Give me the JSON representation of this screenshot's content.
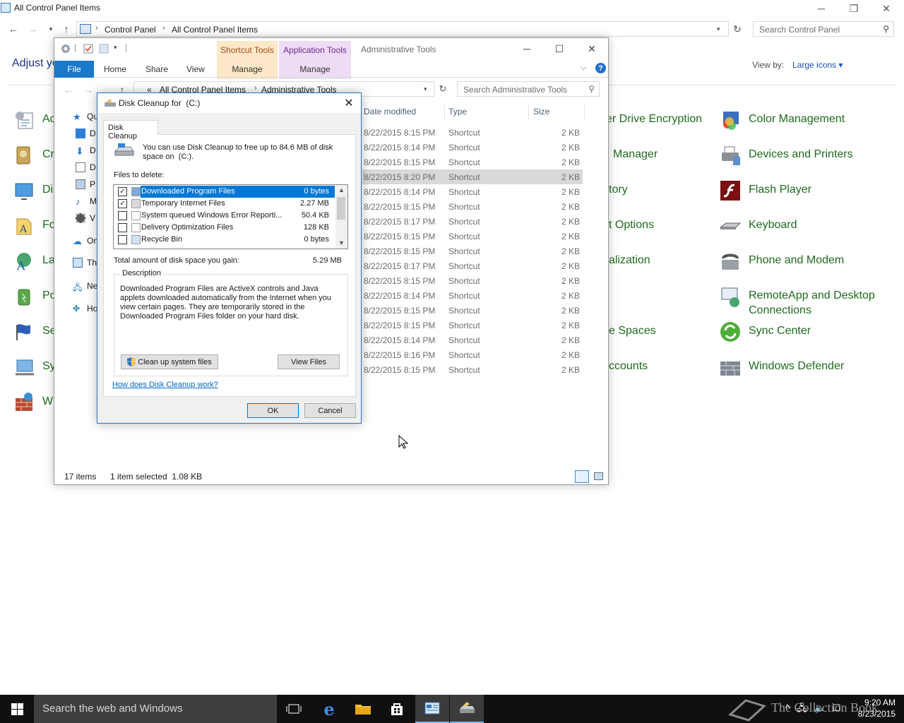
{
  "control_panel": {
    "title": "All Control Panel Items",
    "breadcrumb": [
      "Control Panel",
      "All Control Panel Items"
    ],
    "search_placeholder": "Search Control Panel",
    "heading": "Adjust yo",
    "view_by_label": "View by:",
    "view_by_value": "Large icons ▾",
    "left_items": [
      "Ac",
      "Cr",
      "Di",
      "Fo",
      "La",
      "Po",
      "Se",
      "Sy",
      "W"
    ],
    "mid_items": [
      "er Drive Encryption",
      "Manager",
      "tory",
      "t Options",
      "alization",
      "e Spaces",
      "ccounts"
    ],
    "right_items": [
      "Color Management",
      "Devices and Printers",
      "Flash Player",
      "Keyboard",
      "Phone and Modem",
      "RemoteApp and Desktop Connections",
      "Sync Center",
      "Windows Defender"
    ]
  },
  "explorer": {
    "title": "Administrative Tools",
    "context_tabs": {
      "shortcut_tools": "Shortcut Tools",
      "application_tools": "Application Tools",
      "manage": "Manage"
    },
    "ribbon_tabs": [
      "File",
      "Home",
      "Share",
      "View"
    ],
    "breadcrumb": [
      "«",
      "All Control Panel Items",
      "Administrative Tools"
    ],
    "search_placeholder": "Search Administrative Tools",
    "nav_items": [
      "Qu",
      "D",
      "D",
      "D",
      "P",
      "M",
      "V",
      "On",
      "Th",
      "Ne",
      "Ho"
    ],
    "columns": [
      "Date modified",
      "Type",
      "Size"
    ],
    "rows": [
      {
        "date": "8/22/2015 8:15 PM",
        "type": "Shortcut",
        "size": "2 KB"
      },
      {
        "date": "8/22/2015 8:14 PM",
        "type": "Shortcut",
        "size": "2 KB"
      },
      {
        "date": "8/22/2015 8:15 PM",
        "type": "Shortcut",
        "size": "2 KB"
      },
      {
        "date": "8/22/2015 8:20 PM",
        "type": "Shortcut",
        "size": "2 KB"
      },
      {
        "date": "8/22/2015 8:14 PM",
        "type": "Shortcut",
        "size": "2 KB"
      },
      {
        "date": "8/22/2015 8:15 PM",
        "type": "Shortcut",
        "size": "2 KB"
      },
      {
        "date": "8/22/2015 8:17 PM",
        "type": "Shortcut",
        "size": "2 KB"
      },
      {
        "date": "8/22/2015 8:15 PM",
        "type": "Shortcut",
        "size": "2 KB"
      },
      {
        "date": "8/22/2015 8:15 PM",
        "type": "Shortcut",
        "size": "2 KB"
      },
      {
        "date": "8/22/2015 8:17 PM",
        "type": "Shortcut",
        "size": "2 KB"
      },
      {
        "date": "8/22/2015 8:15 PM",
        "type": "Shortcut",
        "size": "2 KB"
      },
      {
        "date": "8/22/2015 8:14 PM",
        "type": "Shortcut",
        "size": "2 KB"
      },
      {
        "date": "8/22/2015 8:15 PM",
        "type": "Shortcut",
        "size": "2 KB"
      },
      {
        "date": "8/22/2015 8:15 PM",
        "type": "Shortcut",
        "size": "2 KB"
      },
      {
        "date": "8/22/2015 8:14 PM",
        "type": "Shortcut",
        "size": "2 KB"
      },
      {
        "date": "8/22/2015 8:16 PM",
        "type": "Shortcut",
        "size": "2 KB"
      },
      {
        "date": "8/22/2015 8:15 PM",
        "type": "Shortcut",
        "size": "2 KB"
      }
    ],
    "status": {
      "items": "17 items",
      "selected": "1 item selected  1.08 KB"
    }
  },
  "dialog": {
    "title": "Disk Cleanup for  (C:)",
    "tab": "Disk Cleanup",
    "intro": "You can use Disk Cleanup to free up to 84.6 MB of disk space on  (C:).",
    "files_label": "Files to delete:",
    "files": [
      {
        "name": "Downloaded Program Files",
        "size": "0 bytes",
        "checked": true,
        "selected": true
      },
      {
        "name": "Temporary Internet Files",
        "size": "2.27 MB",
        "checked": true,
        "selected": false
      },
      {
        "name": "System queued Windows Error Reporti...",
        "size": "50.4 KB",
        "checked": false,
        "selected": false
      },
      {
        "name": "Delivery Optimization Files",
        "size": "128 KB",
        "checked": false,
        "selected": false
      },
      {
        "name": "Recycle Bin",
        "size": "0 bytes",
        "checked": false,
        "selected": false
      }
    ],
    "total_label": "Total amount of disk space you gain:",
    "total_value": "5.29 MB",
    "description_label": "Description",
    "description": "Downloaded Program Files are ActiveX controls and Java applets downloaded automatically from the Internet when you view certain pages. They are temporarily stored in the Downloaded Program Files folder on your hard disk.",
    "cleanup_button": "Clean up system files",
    "view_files_button": "View Files",
    "help_link": "How does Disk Cleanup work?",
    "ok_button": "OK",
    "cancel_button": "Cancel"
  },
  "taskbar": {
    "search_placeholder": "Search the web and Windows",
    "watermark": "The Collection Book",
    "time": "9:20 AM",
    "date": "8/23/2015"
  },
  "colors": {
    "accent": "#0078d7",
    "file_tab": "#1979ca",
    "link_green": "#1e6b1e",
    "taskbar": "#101010"
  }
}
